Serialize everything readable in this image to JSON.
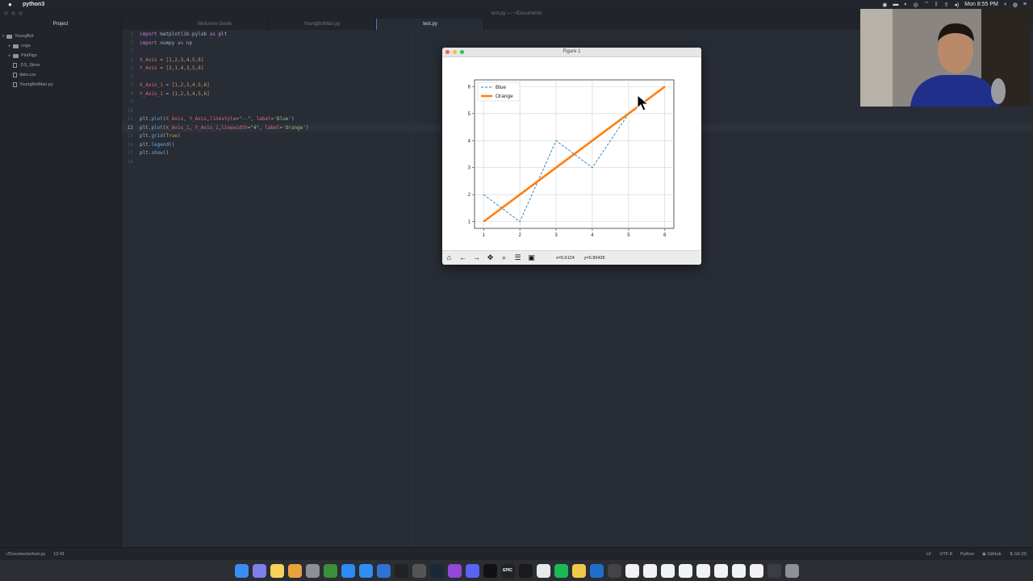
{
  "menubar": {
    "app_name": "python3",
    "clock": "Mon 8:55 PM",
    "icons": [
      "record-icon",
      "screen-icon",
      "camera-icon",
      "airplay-icon",
      "wifi-icon",
      "bluetooth-icon",
      "upload-icon",
      "volume-icon",
      "search-icon",
      "siri-icon",
      "menu-icon"
    ]
  },
  "titlebar": {
    "title": "test.py — ~/Documents"
  },
  "tabs": {
    "project": "Project",
    "items": [
      {
        "label": "Welcome Guide",
        "active": false
      },
      {
        "label": "YoungBotMan.py",
        "active": false
      },
      {
        "label": "test.py",
        "active": true
      }
    ]
  },
  "tree": [
    {
      "label": "YoungBot",
      "type": "folder",
      "expanded": true,
      "depth": 0
    },
    {
      "label": "cogs",
      "type": "folder",
      "expanded": false,
      "depth": 1
    },
    {
      "label": "PlotFigs",
      "type": "folder",
      "expanded": false,
      "depth": 1
    },
    {
      "label": ".DS_Store",
      "type": "file",
      "depth": 1
    },
    {
      "label": "data.csv",
      "type": "file",
      "depth": 1
    },
    {
      "label": "YoungBotMan.py",
      "type": "file",
      "depth": 1
    }
  ],
  "code": [
    "import matplotlib.pylab as plt",
    "import numpy as np",
    "",
    "X_Axis = [1,2,3,4,5,6]",
    "Y_Axis = [2,1,4,3,5,6]",
    "",
    "X_Axis_1 = [1,2,3,4,5,6]",
    "Y_Axis_1 = [1,2,3,4,5,6]",
    "",
    "",
    "plt.plot(X_Axis, Y_Axis,linestyle=\"--\", label='Blue')",
    "plt.plot(X_Axis_1, Y_Axis_1,linewidth=\"4\", label='Orange')",
    "plt.grid(True)",
    "plt.legend()",
    "plt.show()",
    ""
  ],
  "figure": {
    "title": "Figure 1",
    "toolbar": [
      "home-icon",
      "back-icon",
      "forward-icon",
      "pan-icon",
      "zoom-icon",
      "configure-icon",
      "save-icon"
    ],
    "x_readout": "x=5.6124",
    "y_readout": "y=5.89435"
  },
  "chart_data": {
    "type": "line",
    "x": [
      1,
      2,
      3,
      4,
      5,
      6
    ],
    "series": [
      {
        "name": "Blue",
        "values": [
          2,
          1,
          4,
          3,
          5,
          6
        ],
        "color": "#1f77b4",
        "linestyle": "dashed"
      },
      {
        "name": "Orange",
        "values": [
          1,
          2,
          3,
          4,
          5,
          6
        ],
        "color": "#ff7f0e",
        "linestyle": "solid"
      }
    ],
    "xticks": [
      "1",
      "2",
      "3",
      "4",
      "5",
      "6"
    ],
    "yticks": [
      "1",
      "2",
      "3",
      "4",
      "5",
      "6"
    ],
    "xlim": [
      0.75,
      6.25
    ],
    "ylim": [
      0.75,
      6.25
    ],
    "grid": true,
    "legend": "top-left",
    "title": "",
    "xlabel": "",
    "ylabel": ""
  },
  "statusbar": {
    "path": "~/Documents/test.py",
    "cursor": "12:41",
    "line_ending": "LF",
    "encoding": "UTF-8",
    "grammar": "Python",
    "github": "GitHub",
    "git": "Git (0)"
  },
  "dock": {
    "items": [
      "finder-icon",
      "siri-icon",
      "notes-icon",
      "photos-icon",
      "system-preferences-icon",
      "chrome-icon",
      "app-store-icon",
      "safari-icon",
      "xcode-icon",
      "unity-icon",
      "help-icon",
      "steam-icon",
      "podcasts-icon",
      "discord-icon",
      "apple-tv-icon",
      "epic-games-icon",
      "terminal-icon",
      "textedit-icon",
      "spotify-icon",
      "preview-icon",
      "edge-icon",
      "pen-icon",
      "document-icon",
      "document-icon",
      "document-icon",
      "document-icon",
      "document-icon",
      "document-icon",
      "document-icon",
      "document-icon",
      "screenshot-icon",
      "trash-icon"
    ],
    "epic_label": "EPIC"
  }
}
